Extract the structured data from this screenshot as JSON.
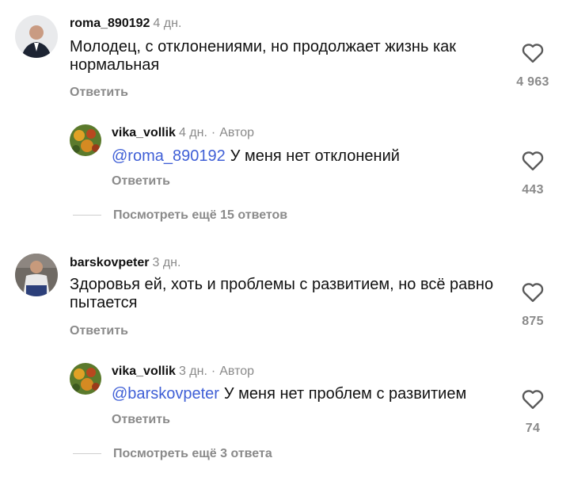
{
  "comments": [
    {
      "username": "roma_890192",
      "time": "4 дн.",
      "text": "Молодец, с отклонениями, но продолжает жизнь как нормальная",
      "reply_label": "Ответить",
      "likes": "4 963"
    },
    {
      "username": "vika_vollik",
      "time": "4 дн.",
      "author_label": "Автор",
      "mention": "@roma_890192",
      "text": "У меня нет отклонений",
      "reply_label": "Ответить",
      "likes": "443"
    },
    {
      "username": "barskovpeter",
      "time": "3 дн.",
      "text": "Здоровья ей, хоть и проблемы с развитием, но всё равно пытается",
      "reply_label": "Ответить",
      "likes": "875"
    },
    {
      "username": "vika_vollik",
      "time": "3 дн.",
      "author_label": "Автор",
      "mention": "@barskovpeter",
      "text": "У меня нет проблем с развитием",
      "reply_label": "Ответить",
      "likes": "74"
    }
  ],
  "view_more": [
    "Посмотреть ещё 15 ответов",
    "Посмотреть ещё 3 ответа"
  ],
  "icons": {
    "like": "heart-outline-icon"
  },
  "colors": {
    "mention": "#3f5fd6",
    "secondary_text": "#8a8a8a"
  }
}
